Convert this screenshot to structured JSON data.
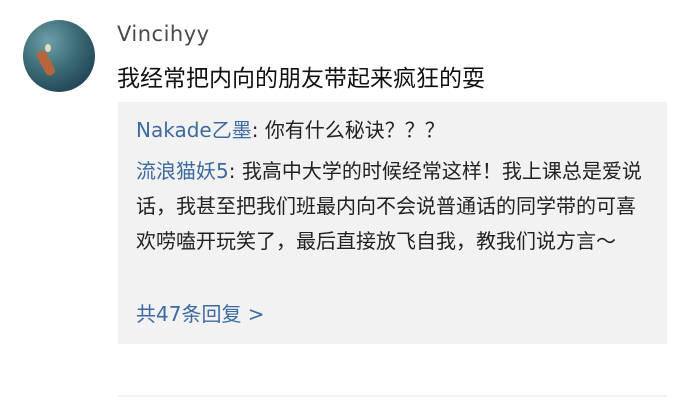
{
  "comment": {
    "username": "Vincihyy",
    "text": "我经常把内向的朋友带起来疯狂的耍"
  },
  "replies": [
    {
      "author": "Nakade乙墨",
      "text": "你有什么秘诀？？？"
    },
    {
      "author": "流浪猫妖5",
      "text": "我高中大学的时候经常这样！我上课总是爱说话，我甚至把我们班最内向不会说普通话的同学带的可喜欢唠嗑开玩笑了，最后直接放飞自我，教我们说方言～"
    }
  ],
  "more_replies_label": "共47条回复 >",
  "colors": {
    "author": "#3d6aa0",
    "reply_bg": "#f2f2f2",
    "text": "#111111",
    "username": "#4a4a4a"
  }
}
